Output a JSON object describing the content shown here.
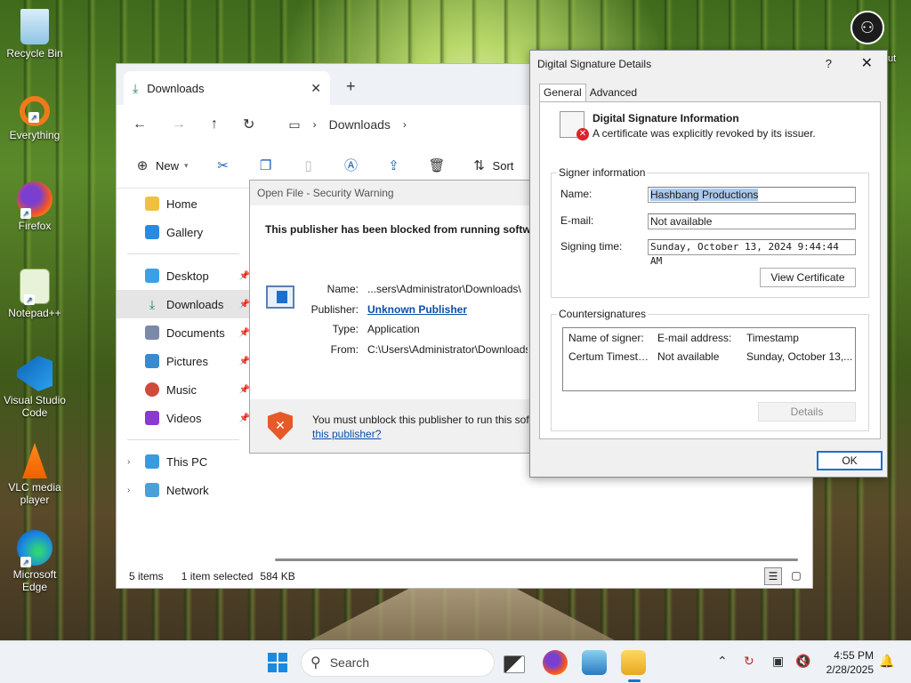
{
  "desktop": {
    "icons": [
      {
        "label": "Recycle Bin"
      },
      {
        "label": "Everything"
      },
      {
        "label": "Firefox"
      },
      {
        "label": "Notepad++"
      },
      {
        "label": "Visual Studio Code"
      },
      {
        "label": "VLC media player"
      },
      {
        "label": "Microsoft Edge"
      }
    ],
    "top_right_label": "ut"
  },
  "explorer": {
    "tab_title": "Downloads",
    "address": "Downloads",
    "toolbar": {
      "new_label": "New",
      "sort_label": "Sort"
    },
    "sidebar": {
      "home": "Home",
      "gallery": "Gallery",
      "desktop": "Desktop",
      "downloads": "Downloads",
      "documents": "Documents",
      "pictures": "Pictures",
      "music": "Music",
      "videos": "Videos",
      "this_pc": "This PC",
      "network": "Network"
    },
    "status": {
      "items": "5 items",
      "selected": "1 item selected",
      "size": "584 KB"
    }
  },
  "security_warning": {
    "title": "Open File - Security Warning",
    "heading": "This publisher has been blocked from running software",
    "fields": {
      "name_label": "Name:",
      "name_value": "...sers\\Administrator\\Downloads\\",
      "publisher_label": "Publisher:",
      "publisher_value": "Unknown Publisher",
      "type_label": "Type:",
      "type_value": "Application",
      "from_label": "From:",
      "from_value": "C:\\Users\\Administrator\\Downloads"
    },
    "footer_message": "You must unblock this publisher to run this software.",
    "footer_link": "this publisher?"
  },
  "signature_details": {
    "title": "Digital Signature Details",
    "help": "?",
    "tabs": [
      "General",
      "Advanced"
    ],
    "info_title": "Digital Signature Information",
    "info_subtitle": "A certificate was explicitly revoked by its issuer.",
    "signer": {
      "group_label": "Signer information",
      "name_label": "Name:",
      "name_value": "Hashbang Productions",
      "email_label": "E-mail:",
      "email_value": "Not available",
      "time_label": "Signing time:",
      "time_value": "Sunday, October 13, 2024 9:44:44 AM",
      "view_cert": "View Certificate"
    },
    "countersignatures": {
      "group_label": "Countersignatures",
      "columns": [
        "Name of signer:",
        "E-mail address:",
        "Timestamp"
      ],
      "rows": [
        [
          "Certum Timesta...",
          "Not available",
          "Sunday, October 13,..."
        ]
      ],
      "details": "Details"
    },
    "ok": "OK"
  },
  "taskbar": {
    "search_placeholder": "Search",
    "time": "4:55 PM",
    "date": "2/28/2025"
  }
}
